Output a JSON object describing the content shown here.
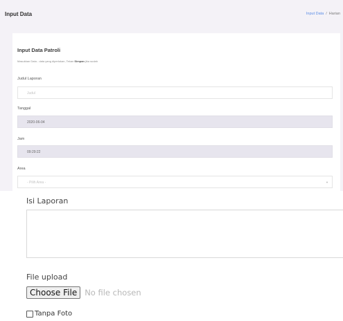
{
  "header": {
    "title": "Input Data",
    "breadcrumb": {
      "link": "Input Data",
      "separator": "/",
      "current": "Harian"
    }
  },
  "form": {
    "title": "Input Data Patroli",
    "hint_before": "Masukkan Data - data yang diperlukan, Tekan ",
    "hint_bold": "Simpan",
    "hint_after": " jika sudah",
    "judul": {
      "label": "Judul Laporan",
      "placeholder": "Judul",
      "value": ""
    },
    "tanggal": {
      "label": "Tanggal",
      "value": "2020-06-04"
    },
    "jam": {
      "label": "Jam",
      "value": "09:29:22"
    },
    "area": {
      "label": "Area",
      "selected": "- Pilih Area -",
      "arrow_icon": "chevron-down-icon"
    },
    "isi": {
      "label": "Isi Laporan",
      "value": ""
    },
    "file": {
      "label": "File upload",
      "button": "Choose File",
      "status": "No file chosen"
    },
    "tanpa_foto": {
      "label": "Tanpa Foto",
      "checked": false
    }
  }
}
